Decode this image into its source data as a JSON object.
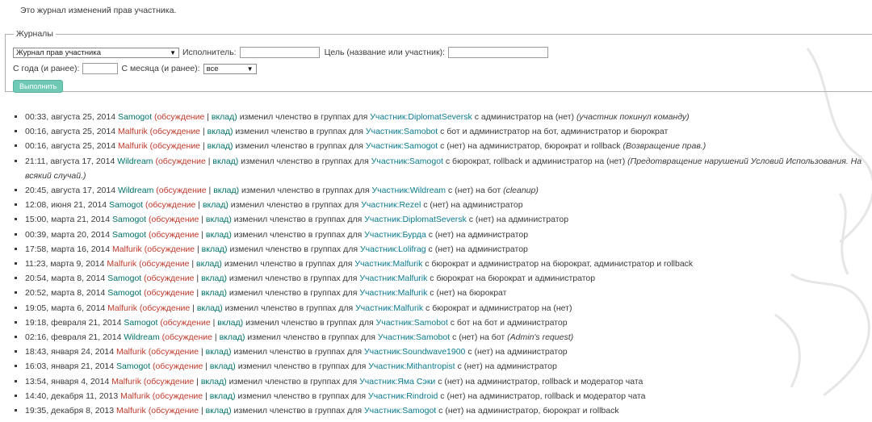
{
  "intro": "Это журнал изменений прав участника.",
  "filters": {
    "legend": "Журналы",
    "log_type": "Журнал прав участника",
    "performer_label": "Исполнитель:",
    "target_label": "Цель (название или участник):",
    "year_label": "С года (и ранее):",
    "month_label": "С месяца (и ранее):",
    "month_value": "все",
    "submit": "Выполнить"
  },
  "links": {
    "talk": "обсуждение",
    "contribs": "вклад",
    "sep": "|"
  },
  "phrase": "изменил членство в группах для",
  "entries": [
    {
      "time": "00:33, августа 25, 2014",
      "user": "Samogot",
      "user_color": "#00716b",
      "target": "Участник:DiplomatSeversk",
      "change": "с администратор на (нет)",
      "comment": "(участник покинул команду)"
    },
    {
      "time": "00:16, августа 25, 2014",
      "user": "Malfurik",
      "user_color": "#c0392b",
      "target": "Участник:Samobot",
      "change": "с бот и администратор на бот, администратор и бюрократ",
      "comment": ""
    },
    {
      "time": "00:16, августа 25, 2014",
      "user": "Malfurik",
      "user_color": "#c0392b",
      "target": "Участник:Samogot",
      "change": "с (нет) на администратор, бюрократ и rollback",
      "comment": "(Возвращение прав.)"
    },
    {
      "time": "21:11, августа 17, 2014",
      "user": "Wildream",
      "user_color": "#00716b",
      "target": "Участник:Samogot",
      "change": "с бюрократ, rollback и администратор на (нет)",
      "comment": "(Предотвращение нарушений Условий Использования. На всякий случай.)"
    },
    {
      "time": "20:45, августа 17, 2014",
      "user": "Wildream",
      "user_color": "#00716b",
      "target": "Участник:Wildream",
      "change": "с (нет) на бот",
      "comment": "(cleanup)"
    },
    {
      "time": "12:08, июня 21, 2014",
      "user": "Samogot",
      "user_color": "#00716b",
      "target": "Участник:Rezel",
      "change": "с (нет) на администратор",
      "comment": ""
    },
    {
      "time": "15:00, марта 21, 2014",
      "user": "Samogot",
      "user_color": "#00716b",
      "target": "Участник:DiplomatSeversk",
      "change": "с (нет) на администратор",
      "comment": ""
    },
    {
      "time": "00:39, марта 20, 2014",
      "user": "Samogot",
      "user_color": "#00716b",
      "target": "Участник:Бурда",
      "change": "с (нет) на администратор",
      "comment": ""
    },
    {
      "time": "17:58, марта 16, 2014",
      "user": "Malfurik",
      "user_color": "#c0392b",
      "target": "Участник:Lolifrag",
      "change": "с (нет) на администратор",
      "comment": ""
    },
    {
      "time": "11:23, марта 9, 2014",
      "user": "Malfurik",
      "user_color": "#c0392b",
      "target": "Участник:Malfurik",
      "change": "с бюрократ и администратор на бюрократ, администратор и rollback",
      "comment": ""
    },
    {
      "time": "20:54, марта 8, 2014",
      "user": "Samogot",
      "user_color": "#00716b",
      "target": "Участник:Malfurik",
      "change": "с бюрократ на бюрократ и администратор",
      "comment": ""
    },
    {
      "time": "20:52, марта 8, 2014",
      "user": "Samogot",
      "user_color": "#00716b",
      "target": "Участник:Malfurik",
      "change": "с (нет) на бюрократ",
      "comment": ""
    },
    {
      "time": "19:05, марта 6, 2014",
      "user": "Malfurik",
      "user_color": "#c0392b",
      "target": "Участник:Malfurik",
      "change": "с бюрократ и администратор на (нет)",
      "comment": ""
    },
    {
      "time": "19:18, февраля 21, 2014",
      "user": "Samogot",
      "user_color": "#00716b",
      "target": "Участник:Samobot",
      "change": "с бот на бот и администратор",
      "comment": ""
    },
    {
      "time": "02:16, февраля 21, 2014",
      "user": "Wildream",
      "user_color": "#00716b",
      "target": "Участник:Samobot",
      "change": "с (нет) на бот",
      "comment": "(Admin's request)"
    },
    {
      "time": "18:43, января 24, 2014",
      "user": "Malfurik",
      "user_color": "#c0392b",
      "target": "Участник:Soundwave1900",
      "change": "с (нет) на администратор",
      "comment": ""
    },
    {
      "time": "16:03, января 21, 2014",
      "user": "Samogot",
      "user_color": "#00716b",
      "target": "Участник:Mithantropist",
      "change": "с (нет) на администратор",
      "comment": ""
    },
    {
      "time": "13:54, января 4, 2014",
      "user": "Malfurik",
      "user_color": "#c0392b",
      "target": "Участник:Яма Сэки",
      "change": "с (нет) на администратор, rollback и модератор чата",
      "comment": ""
    },
    {
      "time": "14:40, декабря 11, 2013",
      "user": "Malfurik",
      "user_color": "#c0392b",
      "target": "Участник:Rindroid",
      "change": "с (нет) на администратор, rollback и модератор чата",
      "comment": ""
    },
    {
      "time": "19:35, декабря 8, 2013",
      "user": "Malfurik",
      "user_color": "#c0392b",
      "target": "Участник:Samogot",
      "change": "с (нет) на администратор, бюрократ и rollback",
      "comment": ""
    }
  ]
}
